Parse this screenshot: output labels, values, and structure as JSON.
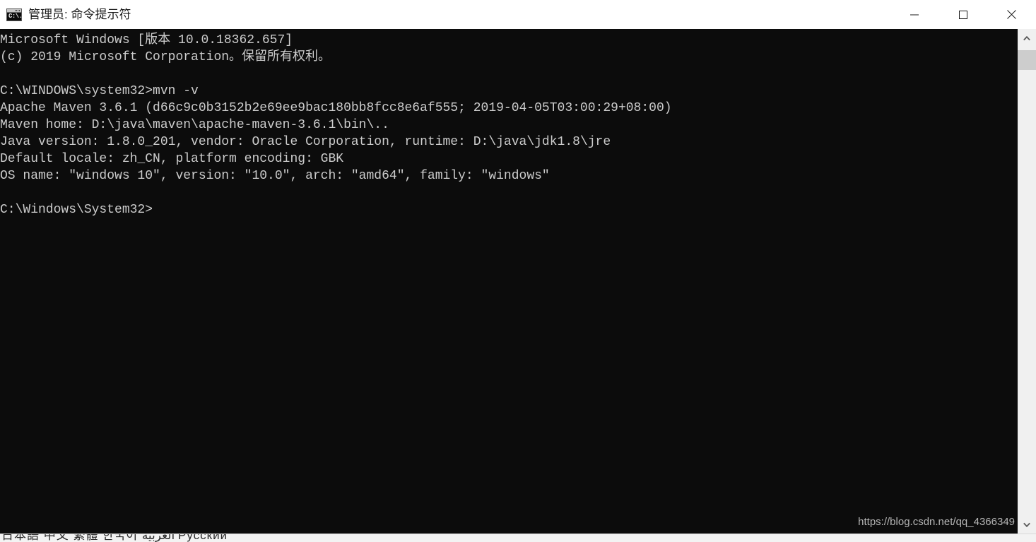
{
  "window": {
    "title": "管理员: 命令提示符",
    "icon": "cmd-icon",
    "icon_prompt_text": "C:\\.",
    "controls": {
      "minimize": "最小化",
      "maximize": "最大化",
      "close": "关闭"
    },
    "background_color": "#0c0c0c",
    "titlebar_color": "#ffffff",
    "text_color": "#cccccc"
  },
  "console": {
    "lines": [
      "Microsoft Windows [版本 10.0.18362.657]",
      "(c) 2019 Microsoft Corporation。保留所有权利。",
      "",
      "C:\\WINDOWS\\system32>mvn -v",
      "Apache Maven 3.6.1 (d66c9c0b3152b2e69ee9bac180bb8fcc8e6af555; 2019-04-05T03:00:29+08:00)",
      "Maven home: D:\\java\\maven\\apache-maven-3.6.1\\bin\\..",
      "Java version: 1.8.0_201, vendor: Oracle Corporation, runtime: D:\\java\\jdk1.8\\jre",
      "Default locale: zh_CN, platform encoding: GBK",
      "OS name: \"windows 10\", version: \"10.0\", arch: \"amd64\", family: \"windows\"",
      "",
      "C:\\Windows\\System32>"
    ],
    "full_text": "Microsoft Windows [版本 10.0.18362.657]\n(c) 2019 Microsoft Corporation。保留所有权利。\n\nC:\\WINDOWS\\system32>mvn -v\nApache Maven 3.6.1 (d66c9c0b3152b2e69ee9bac180bb8fcc8e6af555; 2019-04-05T03:00:29+08:00)\nMaven home: D:\\java\\maven\\apache-maven-3.6.1\\bin\\..\nJava version: 1.8.0_201, vendor: Oracle Corporation, runtime: D:\\java\\jdk1.8\\jre\nDefault locale: zh_CN, platform encoding: GBK\nOS name: \"windows 10\", version: \"10.0\", arch: \"amd64\", family: \"windows\"\n\nC:\\Windows\\System32>",
    "command_entered": "mvn -v",
    "prompt": "C:\\Windows\\System32>",
    "maven_version": "3.6.1",
    "maven_commit": "d66c9c0b3152b2e69ee9bac180bb8fcc8e6af555",
    "maven_build_date": "2019-04-05T03:00:29+08:00",
    "maven_home": "D:\\java\\maven\\apache-maven-3.6.1\\bin\\..",
    "java_version": "1.8.0_201",
    "java_vendor": "Oracle Corporation",
    "java_runtime": "D:\\java\\jdk1.8\\jre",
    "default_locale": "zh_CN",
    "platform_encoding": "GBK",
    "os_name": "windows 10",
    "os_version": "10.0",
    "os_arch": "amd64",
    "os_family": "windows",
    "windows_version": "10.0.18362.657"
  },
  "watermark": {
    "text": "https://blog.csdn.net/qq_4366349"
  },
  "scrollbar": {
    "up_arrow": "scroll-up-icon",
    "down_arrow": "scroll-down-icon",
    "track_color": "#f0f0f0",
    "thumb_color": "#cdcdcd"
  },
  "background_window": {
    "clipped_text": "日本語 中文 繁體 한국어 العربية Русский"
  }
}
